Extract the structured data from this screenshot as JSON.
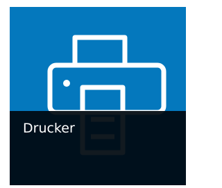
{
  "tile": {
    "label": "Drucker",
    "icon": "printer-icon",
    "background_color": "#0478bd",
    "caption_background": "#00090f",
    "text_color": "#ffffff"
  }
}
